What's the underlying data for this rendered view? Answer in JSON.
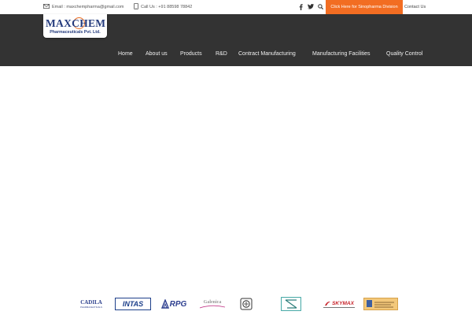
{
  "topbar": {
    "email_label": "Email : maxchempharma@gmail.com",
    "phone_label": "Call Us : +91 88598 78842",
    "promo_label": "Click Here for Sinopharma Division",
    "contact_label": "Contact Us",
    "icons": [
      "envelope-icon",
      "phone-icon",
      "facebook-icon",
      "twitter-icon",
      "search-icon"
    ]
  },
  "brand": {
    "logo_text": "MAXCHEM",
    "logo_sub": "Pharmaceuticals Pvt. Ltd.",
    "colors": {
      "header_bg": "#333333",
      "accent": "#f26d22",
      "logo_blue": "#243b7d"
    }
  },
  "nav": {
    "items": [
      {
        "label": "Home"
      },
      {
        "label": "About us"
      },
      {
        "label": "Products"
      },
      {
        "label": "R&D"
      },
      {
        "label": "Contract Manufacturing"
      },
      {
        "label": "Manufacturing Facilities"
      },
      {
        "label": "Quality Control"
      }
    ]
  },
  "clients": {
    "logos": [
      {
        "label": "CADILA",
        "sub": "PHARMACEUTICALS"
      },
      {
        "label": "INTAS"
      },
      {
        "label": "RPG"
      },
      {
        "label": "Galenica"
      },
      {
        "label": ""
      },
      {
        "label": ""
      },
      {
        "label": "SKYMAX"
      },
      {
        "label": ""
      }
    ]
  }
}
